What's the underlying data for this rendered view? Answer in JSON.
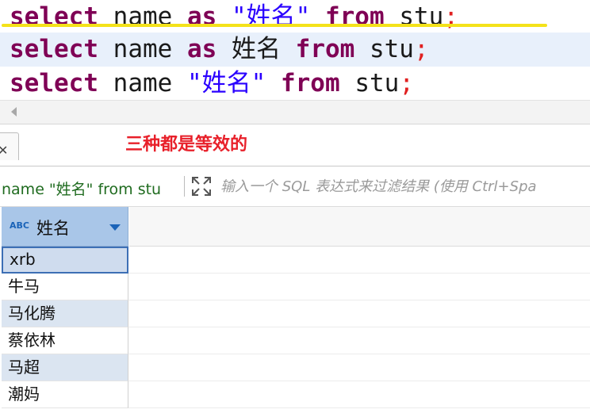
{
  "editor": {
    "lines": [
      {
        "kw1": "select",
        "id1": "name",
        "kw2": "as",
        "str": "\"姓名\"",
        "kw3": "from",
        "id2": "stu",
        "semi": ";"
      },
      {
        "kw1": "select",
        "id1": "name",
        "kw2": "as",
        "alias": "姓名",
        "kw3": "from",
        "id2": "stu",
        "semi": ";"
      },
      {
        "kw1": "select",
        "id1": "name",
        "str": "\"姓名\"",
        "kw3": "from",
        "id2": "stu",
        "semi": ";"
      }
    ]
  },
  "annotation": "三种都是等效的",
  "filter": {
    "query_label": "name \"姓名\" from stu",
    "placeholder": "输入一个 SQL 表达式来过滤结果 (使用 Ctrl+Spa"
  },
  "grid": {
    "column": {
      "type_badge": "ABC",
      "title": "姓名"
    },
    "rows": [
      "xrb",
      "牛马",
      "马化腾",
      "蔡依林",
      "马超",
      "潮妈"
    ]
  },
  "colors": {
    "keyword": "#7f0055",
    "string": "#2a00ff",
    "semicolon": "#e02020",
    "annotation": "#e8202a",
    "highlight": "#f4e21a"
  }
}
